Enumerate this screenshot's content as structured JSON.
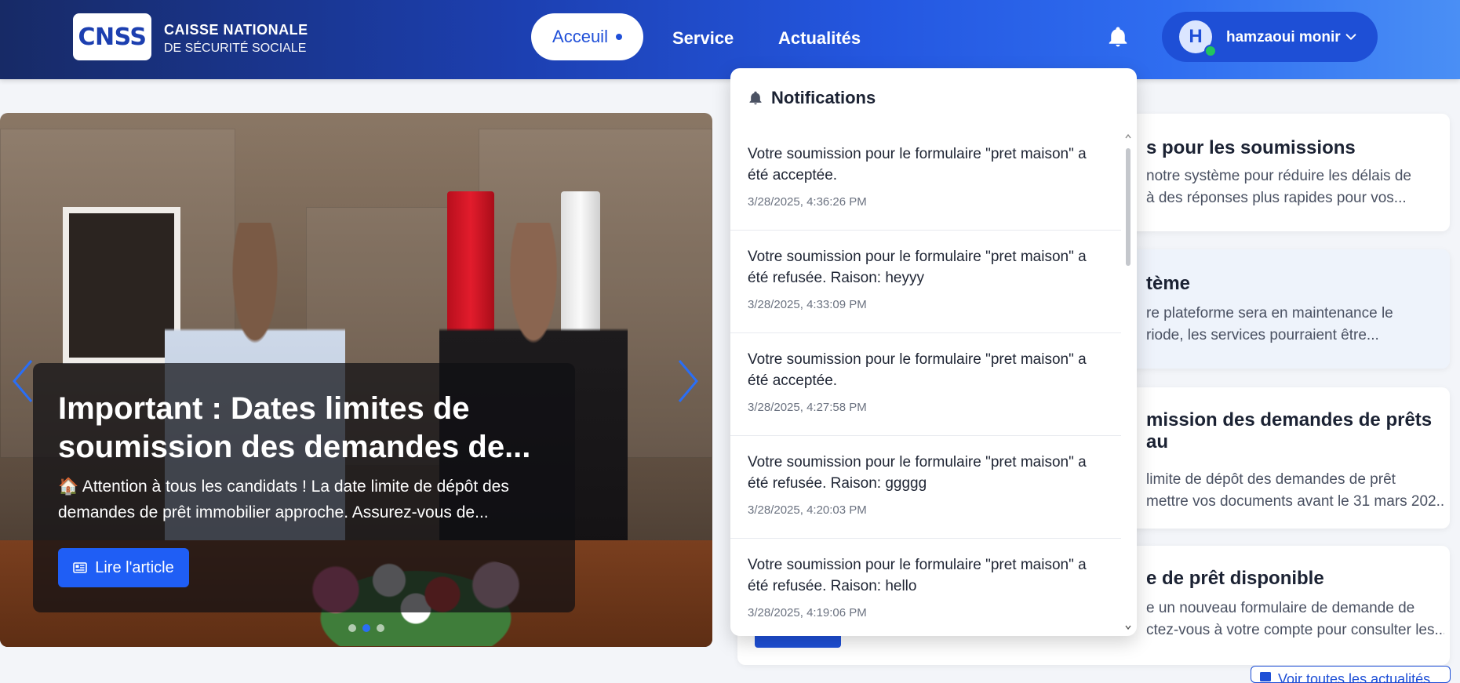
{
  "header": {
    "logo": "CNSS",
    "org_line1": "CAISSE NATIONALE",
    "org_line2": "DE SÉCURITÉ SOCIALE",
    "nav": {
      "active": "Acceuil",
      "service": "Service",
      "actualites": "Actualités"
    },
    "user": {
      "initial": "H",
      "name": "hamzaoui monir"
    }
  },
  "carousel": {
    "title": "Important : Dates limites de soumission des demandes de...",
    "body": "🏠 Attention à tous les candidats ! La date limite de dépôt des demandes de prêt immobilier approche. Assurez-vous de...",
    "button": "Lire l'article"
  },
  "news": [
    {
      "title": "s pour les soumissions",
      "desc1": "notre système pour réduire les délais de",
      "desc2": "à des réponses plus rapides pour vos..."
    },
    {
      "title": "tème",
      "desc1": "re plateforme sera en maintenance le",
      "desc2": "riode, les services pourraient être..."
    },
    {
      "title": "mission des demandes de prêts au",
      "desc1": "limite de dépôt des demandes de prêt",
      "desc2": "mettre vos documents avant le 31 mars 202..."
    },
    {
      "title": "e de prêt disponible",
      "desc1": "e un nouveau formulaire de demande de",
      "desc2": "ctez-vous à votre compte pour consulter les..."
    }
  ],
  "all_news": "Voir toutes les actualités",
  "notifications": {
    "title": "Notifications",
    "items": [
      {
        "message": "Votre soumission pour le formulaire \"pret maison\" a été acceptée.",
        "time": "3/28/2025, 4:36:26 PM"
      },
      {
        "message": "Votre soumission pour le formulaire \"pret maison\" a été refusée. Raison: heyyy",
        "time": "3/28/2025, 4:33:09 PM"
      },
      {
        "message": "Votre soumission pour le formulaire \"pret maison\" a été acceptée.",
        "time": "3/28/2025, 4:27:58 PM"
      },
      {
        "message": "Votre soumission pour le formulaire \"pret maison\" a été refusée. Raison: ggggg",
        "time": "3/28/2025, 4:20:03 PM"
      },
      {
        "message": "Votre soumission pour le formulaire \"pret maison\" a été refusée. Raison: hello",
        "time": "3/28/2025, 4:19:06 PM"
      }
    ]
  },
  "colors": {
    "primary": "#1f4fd8",
    "header_dark": "#172a66",
    "online": "#22c55e"
  }
}
